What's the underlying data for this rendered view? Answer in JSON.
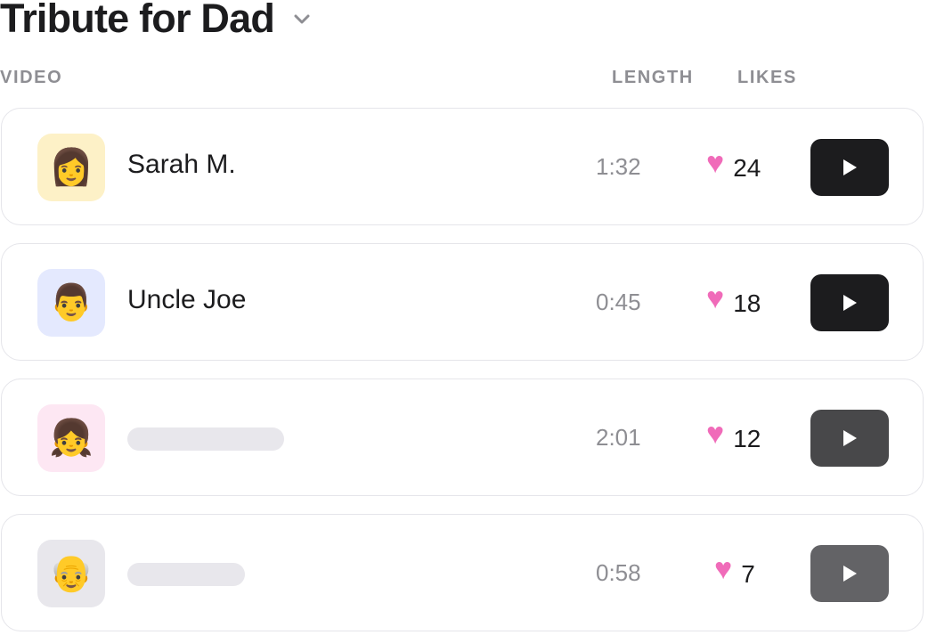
{
  "header": {
    "title": "Tribute for Dad"
  },
  "columns": {
    "video": "VIDEO",
    "length": "LENGTH",
    "likes": "LIKES"
  },
  "colors": {
    "heart": "#f06bb9",
    "placeholder": "#e8e7ec"
  },
  "rows": [
    {
      "avatar_emoji": "👩",
      "avatar_bg": "#fdf1c7",
      "name": "Sarah M.",
      "length": "1:32",
      "likes": "24",
      "heart": "♥",
      "play_color": "#1c1c1e"
    },
    {
      "avatar_emoji": "👨",
      "avatar_bg": "#e4e9fe",
      "name": "Uncle Joe",
      "length": "0:45",
      "likes": "18",
      "heart": "♥",
      "play_color": "#1c1c1e"
    },
    {
      "avatar_emoji": "👧",
      "avatar_bg": "#fde7f3",
      "name": "",
      "length": "2:01",
      "likes": "12",
      "heart": "♥",
      "play_color": "#48484a"
    },
    {
      "avatar_emoji": "👴",
      "avatar_bg": "#e8e7ec",
      "name": "",
      "length": "0:58",
      "likes": "7",
      "heart": "♥",
      "play_color": "#636366"
    }
  ]
}
